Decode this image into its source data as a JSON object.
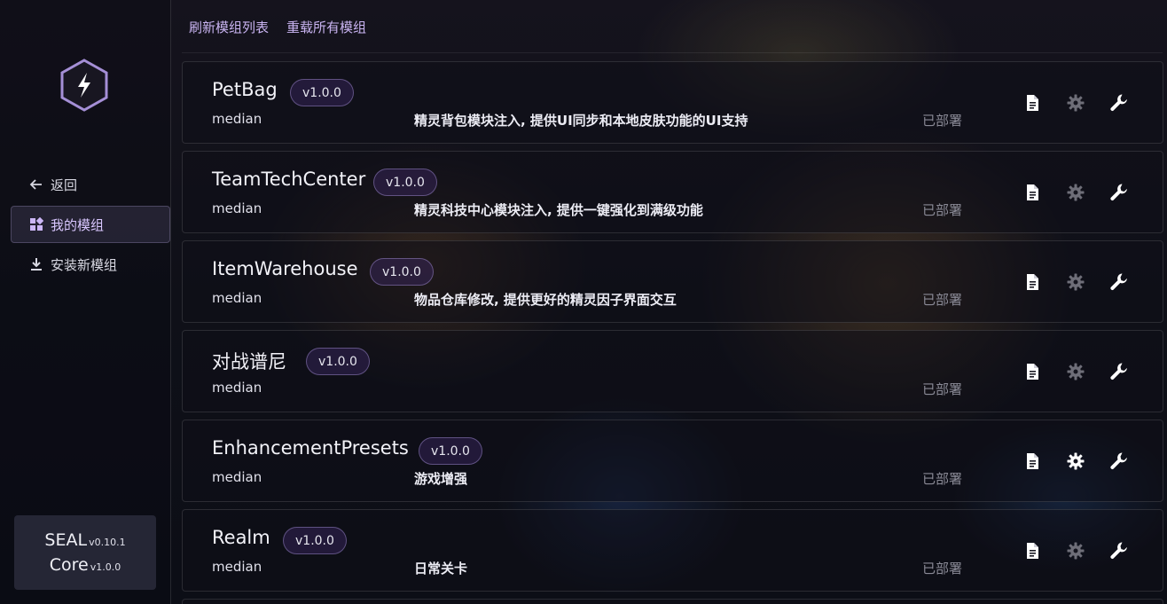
{
  "sidebar": {
    "logo_icon": "lightning-hex-icon",
    "nav": [
      {
        "label": "返回",
        "icon": "arrow-left-icon",
        "active": false
      },
      {
        "label": "我的模组",
        "icon": "grid-icon",
        "active": true
      },
      {
        "label": "安装新模组",
        "icon": "download-icon",
        "active": false
      }
    ],
    "version": {
      "seal_name": "SEAL",
      "seal_version": "v0.10.1",
      "core_name": "Core",
      "core_version": "v1.0.0"
    }
  },
  "topbar": {
    "refresh_label": "刷新模组列表",
    "reload_label": "重载所有模组"
  },
  "modules": [
    {
      "name": "PetBag",
      "version": "v1.0.0",
      "author": "median",
      "description": "精灵背包模块注入, 提供UI同步和本地皮肤功能的UI支持",
      "status": "已部署",
      "settings_enabled": false
    },
    {
      "name": "TeamTechCenter",
      "version": "v1.0.0",
      "author": "median",
      "description": "精灵科技中心模块注入, 提供一键强化到满级功能",
      "status": "已部署",
      "settings_enabled": false
    },
    {
      "name": "ItemWarehouse",
      "version": "v1.0.0",
      "author": "median",
      "description": "物品仓库修改, 提供更好的精灵因子界面交互",
      "status": "已部署",
      "settings_enabled": false
    },
    {
      "name": "对战谱尼",
      "version": "v1.0.0",
      "author": "median",
      "description": "",
      "status": "已部署",
      "settings_enabled": false
    },
    {
      "name": "EnhancementPresets",
      "version": "v1.0.0",
      "author": "median",
      "description": "游戏增强",
      "status": "已部署",
      "settings_enabled": true
    },
    {
      "name": "Realm",
      "version": "v1.0.0",
      "author": "median",
      "description": "日常关卡",
      "status": "已部署",
      "settings_enabled": false
    }
  ],
  "colors": {
    "accent": "#c8b3f0",
    "status_text": "#8a8a96",
    "icon_active": "#ffffff",
    "icon_disabled": "#6e6e78"
  }
}
